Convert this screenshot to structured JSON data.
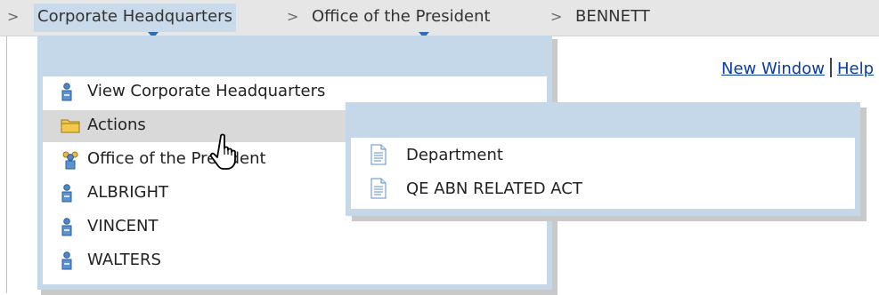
{
  "breadcrumb": {
    "items": [
      "Corporate Headquarters",
      "Office of the President",
      "BENNETT"
    ],
    "separator": ">"
  },
  "links": {
    "new_window": "New Window",
    "help": "Help"
  },
  "menu": {
    "items": [
      {
        "label": "View Corporate Headquarters",
        "icon": "person-icon"
      },
      {
        "label": "Actions",
        "icon": "folder-icon"
      },
      {
        "label": "Office of the President",
        "icon": "group-icon"
      },
      {
        "label": "ALBRIGHT",
        "icon": "person-icon"
      },
      {
        "label": "VINCENT",
        "icon": "person-icon"
      },
      {
        "label": "WALTERS",
        "icon": "person-icon"
      }
    ]
  },
  "submenu": {
    "items": [
      {
        "label": "Department",
        "icon": "document-icon"
      },
      {
        "label": "QE ABN RELATED ACT",
        "icon": "document-icon"
      }
    ]
  },
  "colors": {
    "menu_frame": "#c5d8ea",
    "link": "#0b3c9e",
    "caret": "#2f6cb3",
    "hover": "#d9d9d9"
  }
}
